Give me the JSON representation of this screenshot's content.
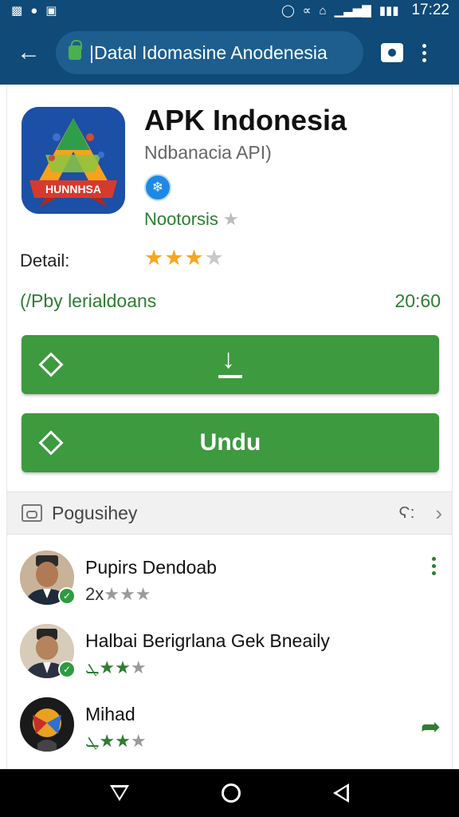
{
  "status_bar": {
    "time": "17:22",
    "icons": [
      "sim-icon",
      "whatsapp-icon",
      "image-icon",
      "alarm-icon",
      "mute-icon",
      "wifi-icon",
      "signal-icon",
      "battery-icon"
    ]
  },
  "browser": {
    "url_text": "|Datal Idomasine Anodenesia",
    "back_icon": "back-arrow-icon",
    "lock_icon": "lock-icon",
    "tab_icon": "tab-switcher-icon",
    "menu_icon": "overflow-menu-icon",
    "theme_color": "#0f4a78"
  },
  "app": {
    "title": "APK Indonesia",
    "subtitle": "Ndbanacia API)",
    "icon_text": "HUNNHSA",
    "developer": "Nootorsis",
    "developer_star": "★",
    "detail_label": "Detail:",
    "rating_stars_filled": 3,
    "rating_stars_total": 4,
    "publisher": "(/Pby lerialdoans",
    "size": "20:60"
  },
  "buttons": {
    "download_icon": "download-icon",
    "unduh_label": "Undu",
    "accent_color": "#3d9a3f"
  },
  "section": {
    "title": "Pogusihey",
    "more_label": "Ϛ:",
    "chevron": "›"
  },
  "reviews": [
    {
      "name": "Pupirs Dendoab",
      "prefix": "2x",
      "green_stars": 0,
      "grey_stars": 3,
      "action_icon": "overflow-menu-icon"
    },
    {
      "name": "Halbai Berigrlana Gek Bneaily",
      "prefix": "ܛ",
      "green_stars": 2,
      "grey_stars": 1,
      "action_icon": ""
    },
    {
      "name": "Mihad",
      "prefix": "ܛ",
      "green_stars": 2,
      "grey_stars": 1,
      "action_icon": "share-icon"
    }
  ],
  "nav_bar": {
    "icons": [
      "nav-back-icon",
      "nav-home-icon",
      "nav-recents-icon"
    ]
  }
}
